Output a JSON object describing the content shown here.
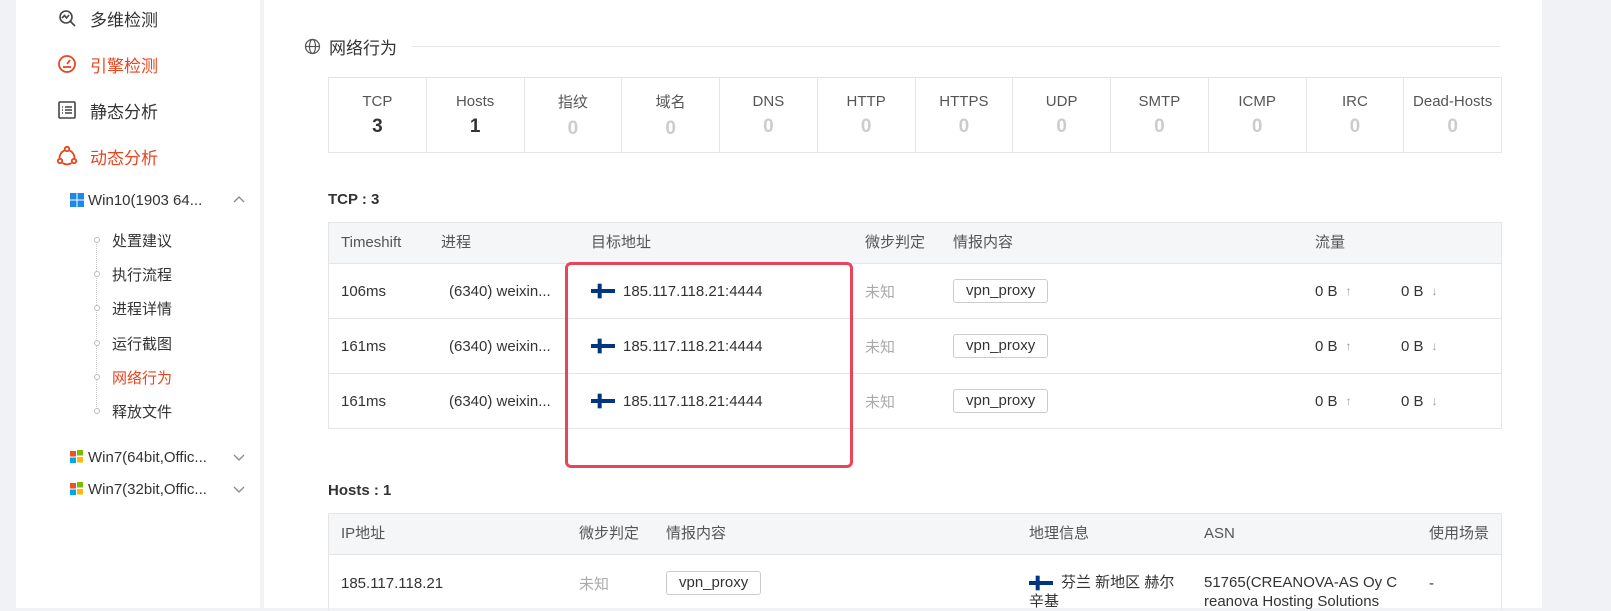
{
  "sidebar": {
    "items": [
      {
        "label": "多维检测",
        "icon": "multi-search-icon"
      },
      {
        "label": "引擎检测",
        "icon": "engine-gauge-icon"
      },
      {
        "label": "静态分析",
        "icon": "list-doc-icon"
      },
      {
        "label": "动态分析",
        "icon": "share-nodes-icon"
      }
    ],
    "env_open": "Win10(1903 64...",
    "sub_items": [
      "处置建议",
      "执行流程",
      "进程详情",
      "运行截图",
      "网络行为",
      "释放文件"
    ],
    "env_collapsed": [
      "Win7(64bit,Offic...",
      "Win7(32bit,Offic..."
    ]
  },
  "section": {
    "title": "网络行为"
  },
  "stats": [
    {
      "label": "TCP",
      "value": "3"
    },
    {
      "label": "Hosts",
      "value": "1"
    },
    {
      "label": "指纹",
      "value": "0"
    },
    {
      "label": "域名",
      "value": "0"
    },
    {
      "label": "DNS",
      "value": "0"
    },
    {
      "label": "HTTP",
      "value": "0"
    },
    {
      "label": "HTTPS",
      "value": "0"
    },
    {
      "label": "UDP",
      "value": "0"
    },
    {
      "label": "SMTP",
      "value": "0"
    },
    {
      "label": "ICMP",
      "value": "0"
    },
    {
      "label": "IRC",
      "value": "0"
    },
    {
      "label": "Dead-Hosts",
      "value": "0"
    }
  ],
  "tcp": {
    "title": "TCP : 3",
    "headers": [
      "Timeshift",
      "进程",
      "目标地址",
      "微步判定",
      "情报内容",
      "流量"
    ],
    "rows": [
      {
        "timeshift": "106ms",
        "process": "(6340)  weixin...",
        "target": "185.117.118.21:4444",
        "verdict": "未知",
        "intel": "vpn_proxy",
        "up": "0 B",
        "down": "0 B"
      },
      {
        "timeshift": "161ms",
        "process": "(6340)  weixin...",
        "target": "185.117.118.21:4444",
        "verdict": "未知",
        "intel": "vpn_proxy",
        "up": "0 B",
        "down": "0 B"
      },
      {
        "timeshift": "161ms",
        "process": "(6340)  weixin...",
        "target": "185.117.118.21:4444",
        "verdict": "未知",
        "intel": "vpn_proxy",
        "up": "0 B",
        "down": "0 B"
      }
    ]
  },
  "hosts": {
    "title": "Hosts : 1",
    "headers": [
      "IP地址",
      "微步判定",
      "情报内容",
      "地理信息",
      "ASN",
      "使用场景"
    ],
    "rows": [
      {
        "ip": "185.117.118.21",
        "verdict": "未知",
        "intel": "vpn_proxy",
        "geo_line1": "芬兰 新地区 赫尔",
        "geo_line2": "辛基",
        "asn_line1": "51765(CREANOVA-AS Oy C",
        "asn_line2": "reanova Hosting Solutions",
        "scene": "-"
      }
    ]
  },
  "colors": {
    "accent": "#e8451f",
    "highlight": "#e8455a",
    "flag_blue": "#003580"
  }
}
